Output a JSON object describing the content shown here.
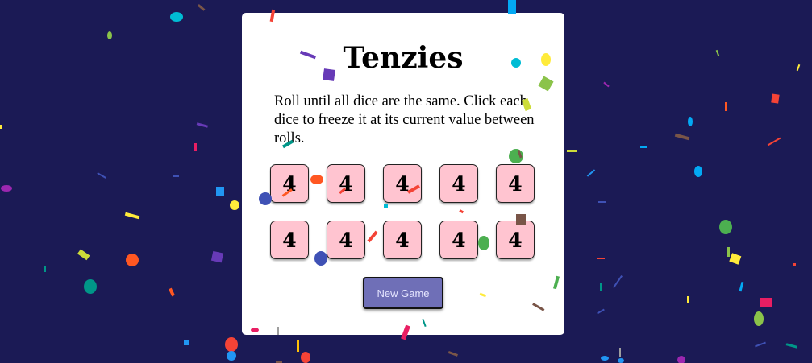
{
  "game": {
    "title": "Tenzies",
    "instructions": "Roll until all dice are the same. Click each dice to freeze it at its current value between rolls.",
    "dice": [
      "4",
      "4",
      "4",
      "4",
      "4",
      "4",
      "4",
      "4",
      "4",
      "4"
    ],
    "new_game_label": "New Game"
  },
  "colors": {
    "background": "#1b1a55",
    "card": "#ffffff",
    "die_face": "#ffc4d0",
    "button": "#6f6fb7",
    "confetti": [
      "#f44336",
      "#e91e63",
      "#9c27b0",
      "#673ab7",
      "#3f51b5",
      "#2196f3",
      "#03a9f4",
      "#00bcd4",
      "#009688",
      "#4caf50",
      "#8bc34a",
      "#cddc39",
      "#ffeb3b",
      "#ffc107",
      "#ff9800",
      "#ff5722",
      "#795548"
    ]
  }
}
